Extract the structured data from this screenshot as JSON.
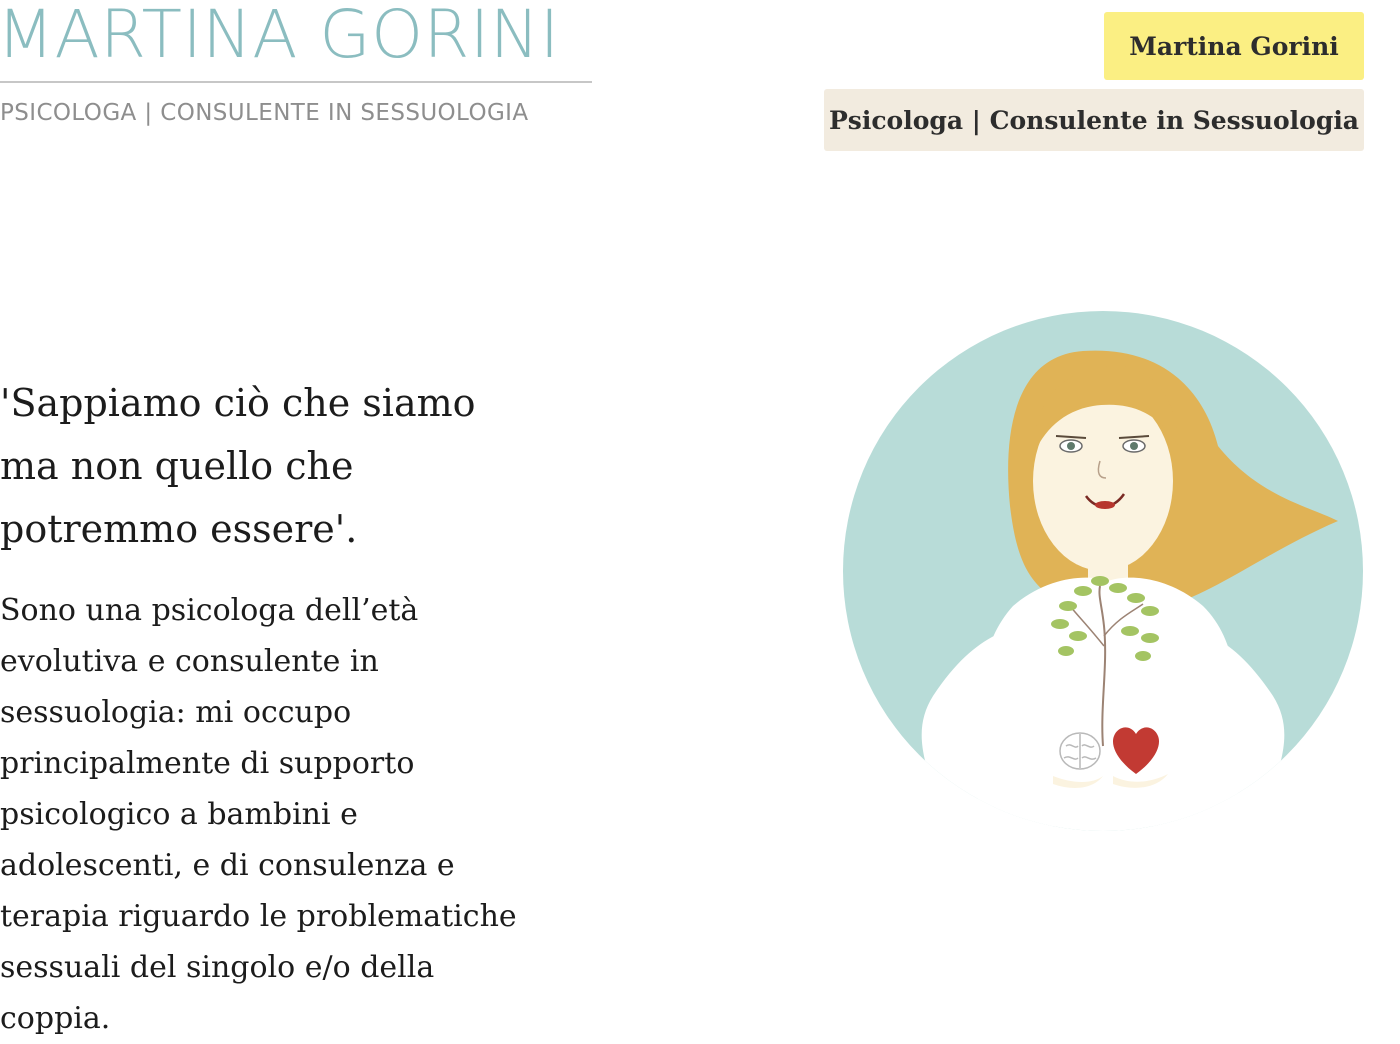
{
  "header": {
    "logo_name": "MARTINA GORINI",
    "logo_tagline": "PSICOLOGA | CONSULENTE IN SESSUOLOGIA",
    "button_name": "Martina Gorini",
    "button_profession": "Psicologa | Consulente in Sessuologia"
  },
  "main": {
    "quote": "'Sappiamo ciò che siamo ma non quello che potremmo essere'.",
    "bio": "Sono una psicologa dell’età evolutiva e consulente in sessuologia: mi occupo principalmente di supporto psicologico a bambini e adolescenti, e di consulenza e terapia riguardo le problematiche sessuali del singolo e/o della coppia."
  },
  "colors": {
    "logo": "#8bbdc0",
    "tagline": "#8e8e8e",
    "button_name_bg": "#fbef83",
    "button_profession_bg": "#f2ebdf",
    "circle_bg": "#b8dcd8",
    "hair": "#e0b356",
    "heart": "#c23a33",
    "leaves": "#a4c463"
  }
}
